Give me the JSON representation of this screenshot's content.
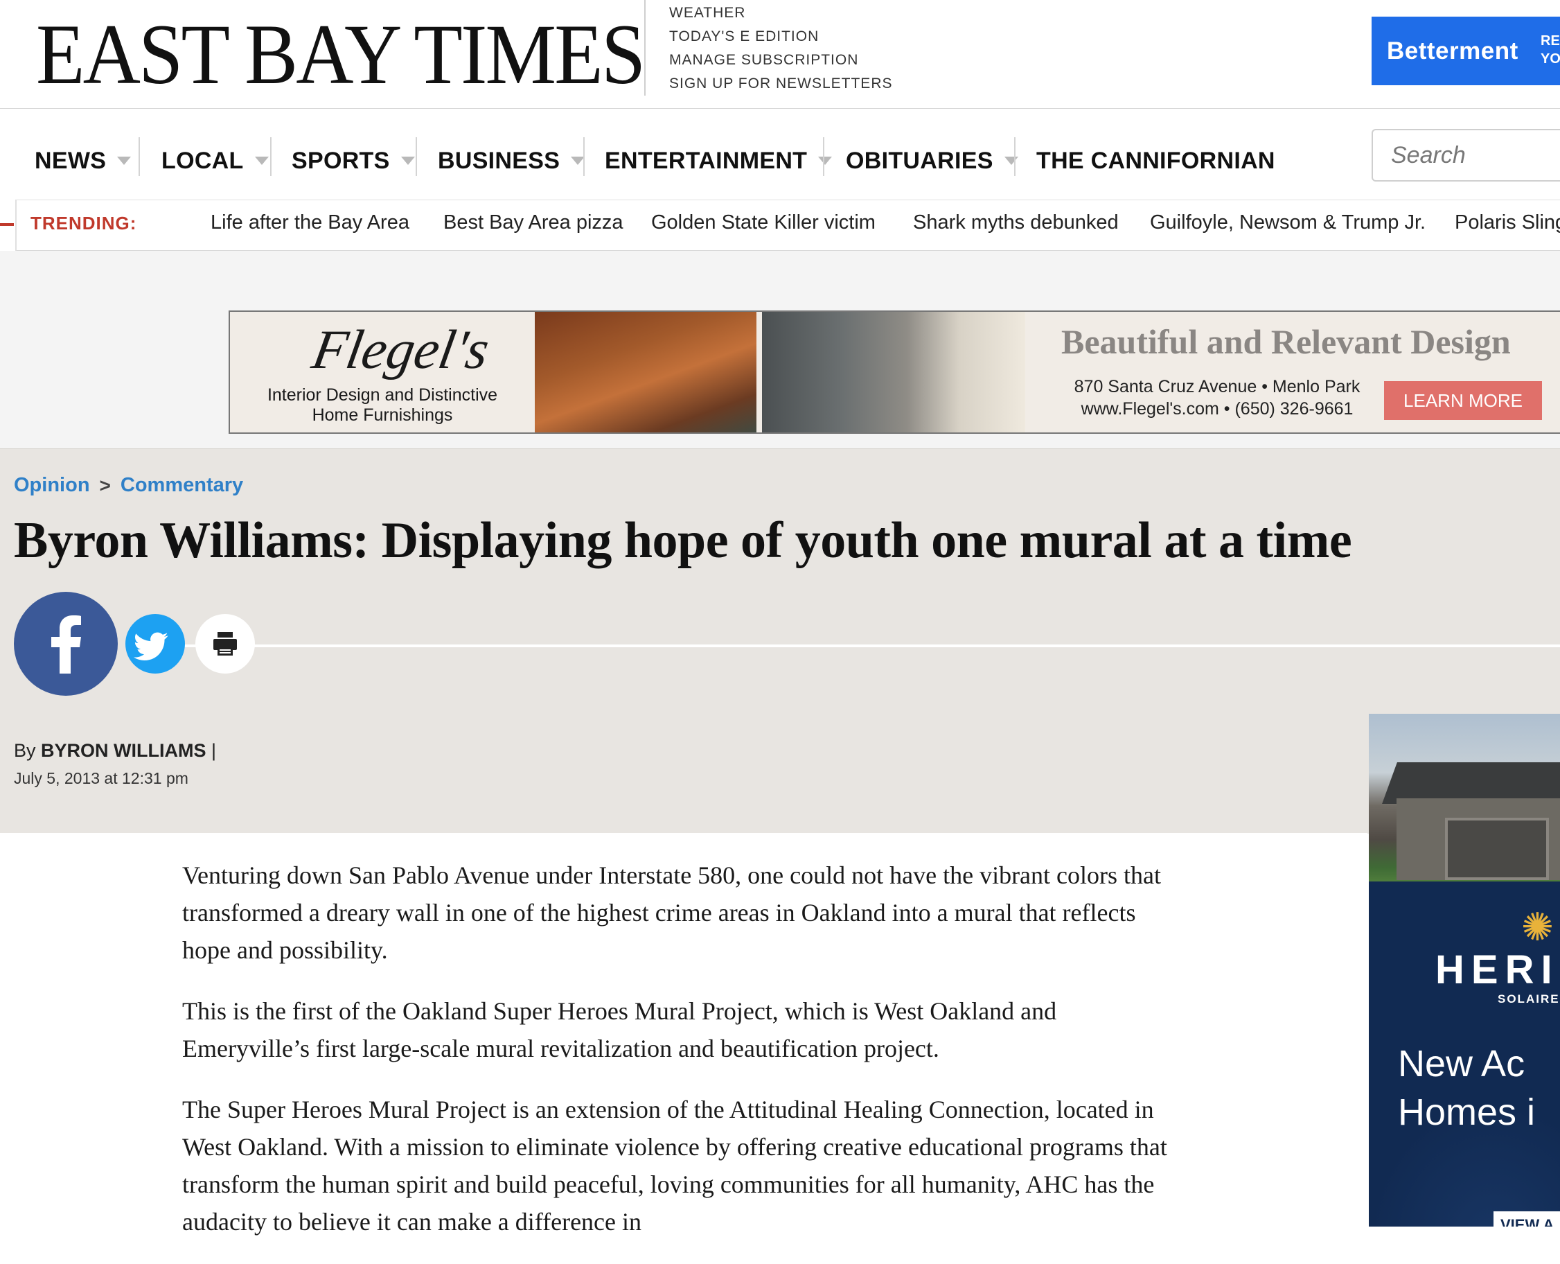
{
  "masthead": {
    "logo": "EAST BAY TIMES",
    "util_links": [
      "WEATHER",
      "TODAY'S E EDITION",
      "MANAGE SUBSCRIPTION",
      "SIGN UP FOR NEWSLETTERS"
    ],
    "top_ad": {
      "brand": "Betterment",
      "small_line1": "RE",
      "small_line2": "YO",
      "color": "#1f6de8"
    }
  },
  "nav": {
    "items": [
      {
        "label": "NEWS"
      },
      {
        "label": "LOCAL"
      },
      {
        "label": "SPORTS"
      },
      {
        "label": "BUSINESS"
      },
      {
        "label": "ENTERTAINMENT"
      },
      {
        "label": "OBITUARIES"
      },
      {
        "label": "THE CANNIFORNIAN"
      }
    ],
    "search_placeholder": "Search"
  },
  "trending": {
    "label": "TRENDING:",
    "items": [
      "Life after the Bay Area",
      "Best Bay Area pizza",
      "Golden State Killer victim",
      "Shark myths debunked",
      "Guilfoyle, Newsom & Trump Jr.",
      "Polaris Sling"
    ],
    "accent_color": "#c0392b"
  },
  "ad_banner": {
    "logo": "Flegel's",
    "tagline": "Interior Design and Distinctive Home Furnishings",
    "headline": "Beautiful and Relevant Design",
    "address_line1": "870 Santa Cruz Avenue • Menlo Park",
    "address_line2": "www.Flegel's.com • (650) 326-9661",
    "cta": "LEARN MORE"
  },
  "article": {
    "breadcrumb": [
      "Opinion",
      "Commentary"
    ],
    "breadcrumb_sep": ">",
    "headline": "Byron Williams: Displaying hope of youth one mural at a time",
    "share": {
      "facebook_icon": "f",
      "twitter_icon": "twitter-bird",
      "print_icon": "printer"
    },
    "byline_prefix": "By ",
    "author": "BYRON WILLIAMS",
    "byline_suffix": " |",
    "date": "July 5, 2013 at 12:31 pm",
    "paragraphs": [
      "Venturing down San Pablo Avenue under Interstate 580, one could not have the vibrant colors that transformed a dreary wall in one of the highest crime areas in Oakland into a mural that reflects hope and possibility.",
      "This is the first of the Oakland Super Heroes Mural Project, which is West Oakland and Emeryville’s first large-scale mural revitalization and beautification project.",
      "The Super Heroes Mural Project is an extension of the Attitudinal Healing Connection, located in West Oakland. With a mission to eliminate violence by offering creative educational programs that transform the human spirit and build peaceful, loving communities for all humanity, AHC has the audacity to believe it can make a difference in"
    ],
    "link_color": "#2f80c8"
  },
  "rail_ad": {
    "brand": "HERI",
    "sub": "SOLAIRE",
    "line1": "New Ac",
    "line2": "Homes i",
    "button": "VIEW A"
  }
}
